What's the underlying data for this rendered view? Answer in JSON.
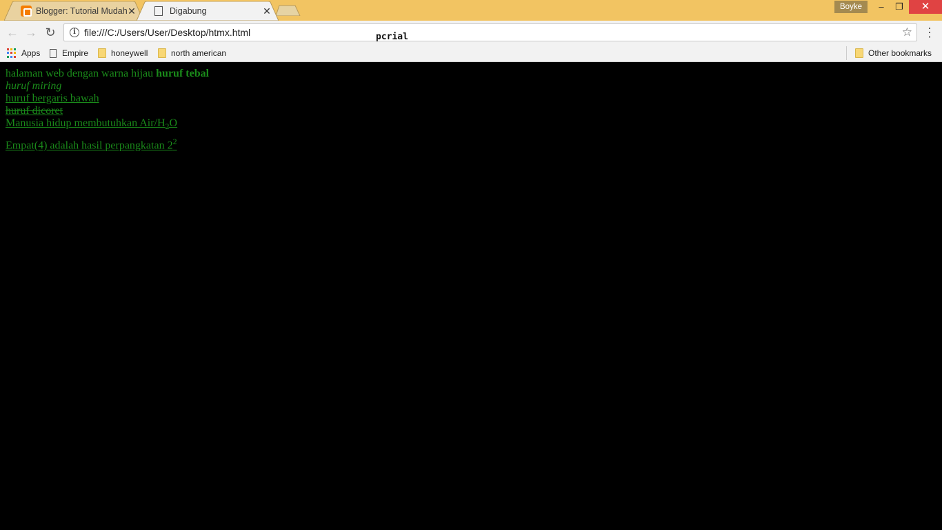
{
  "tabs": [
    {
      "title": "Blogger: Tutorial Mudah",
      "icon": "blogger-icon",
      "active": false
    },
    {
      "title": "Digabung",
      "icon": "document-icon",
      "active": true
    }
  ],
  "window": {
    "profile_name": "Boyke",
    "minimize": "–",
    "maximize": "❐",
    "close": "✕"
  },
  "toolbar": {
    "url": "file:///C:/Users/User/Desktop/htmx.html",
    "back": "←",
    "forward": "→",
    "reload": "↻",
    "info": "i",
    "star": "☆",
    "menu": "⋮"
  },
  "overlay_label": "pcrial",
  "bookmarks": {
    "items": [
      {
        "label": "Apps",
        "icon": "apps-icon"
      },
      {
        "label": "Empire",
        "icon": "page-icon"
      },
      {
        "label": "honeywell",
        "icon": "folder-icon"
      },
      {
        "label": "north american",
        "icon": "folder-icon"
      }
    ],
    "other": {
      "label": "Other bookmarks",
      "icon": "folder-icon"
    }
  },
  "page": {
    "line1_normal": "halaman web dengan warna hijau ",
    "line1_bold": "huruf tebal",
    "line2_italic": "huruf miring",
    "line3_underline": "huruf bergaris bawah",
    "line4_strike": "huruf dicoret",
    "line5_text": "Manusia hidup membutuhkan Air/H",
    "line5_sub": "2",
    "line5_end": "O",
    "line6_text": "Empat(4) adalah hasil perpangkatan 2",
    "line6_sup": "2"
  },
  "colors": {
    "text": "#1a8a1a",
    "background": "#000000",
    "titlebar": "#f2c462"
  }
}
